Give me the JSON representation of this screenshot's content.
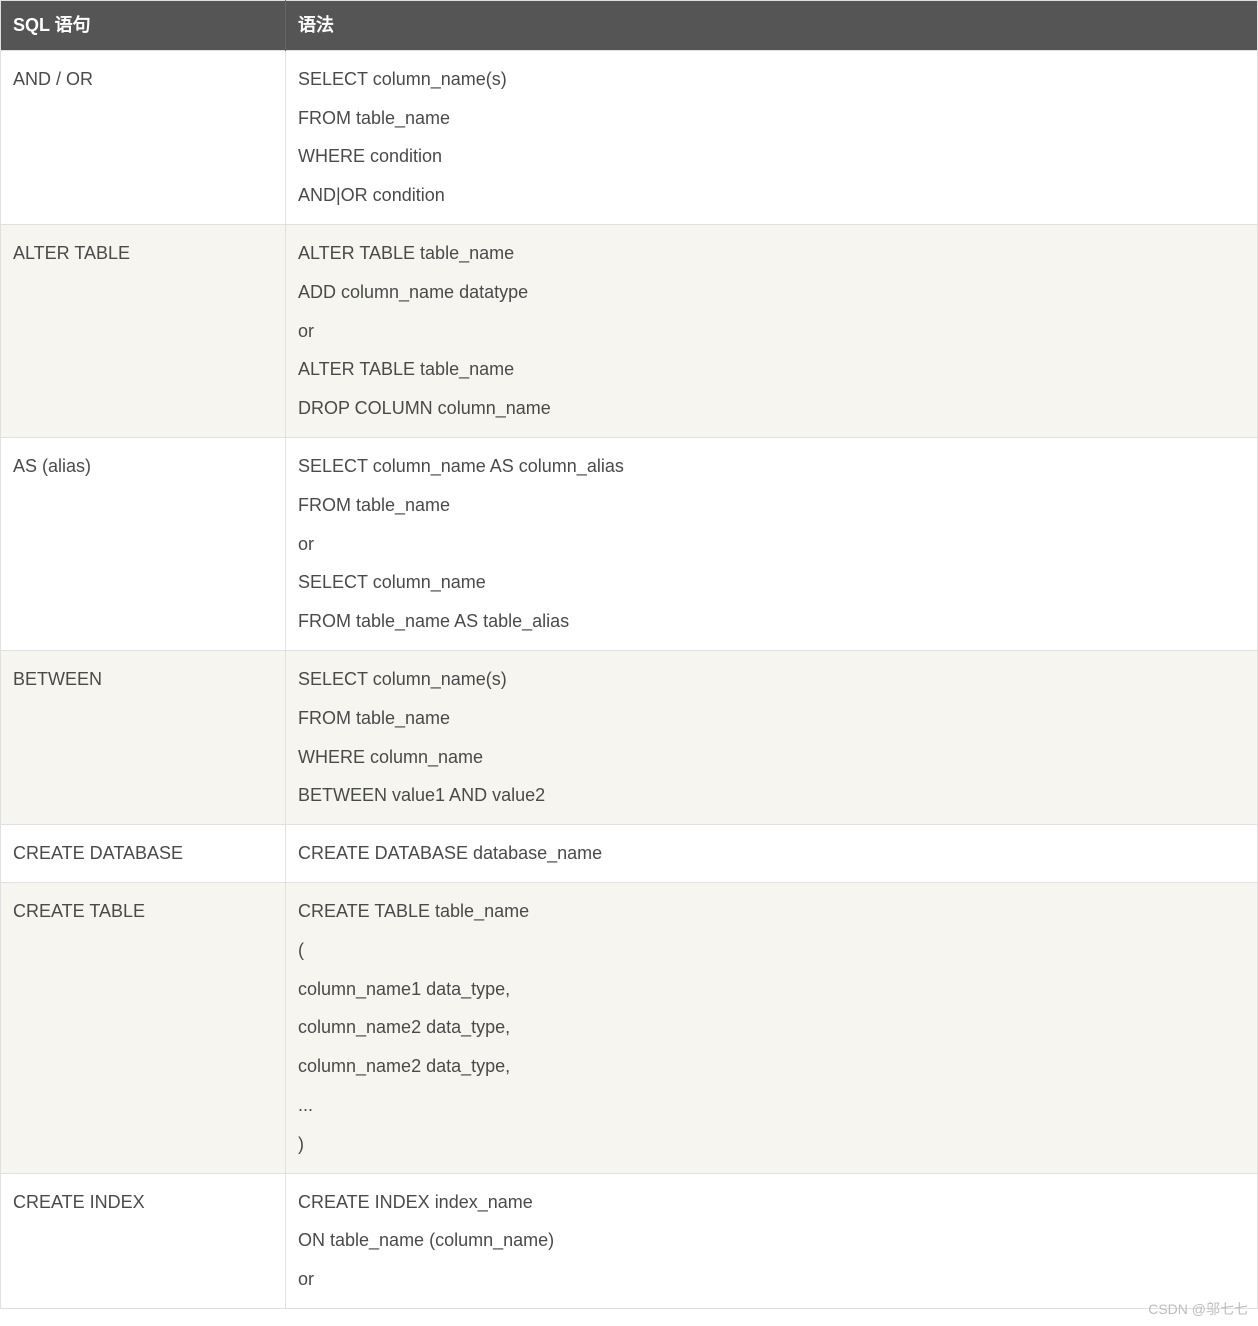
{
  "headers": {
    "col1": "SQL 语句",
    "col2": "语法"
  },
  "rows": [
    {
      "statement": "AND / OR",
      "syntax": [
        "SELECT column_name(s)",
        "FROM table_name",
        "WHERE condition",
        "AND|OR condition"
      ]
    },
    {
      "statement": "ALTER TABLE",
      "syntax": [
        "ALTER TABLE table_name",
        "ADD column_name datatype",
        "or",
        "ALTER TABLE table_name",
        "DROP COLUMN column_name"
      ]
    },
    {
      "statement": "AS (alias)",
      "syntax": [
        "SELECT column_name AS column_alias",
        "FROM table_name",
        "or",
        "SELECT column_name",
        "FROM table_name AS table_alias"
      ]
    },
    {
      "statement": "BETWEEN",
      "syntax": [
        "SELECT column_name(s)",
        "FROM table_name",
        "WHERE column_name",
        "BETWEEN value1 AND value2"
      ]
    },
    {
      "statement": "CREATE DATABASE",
      "syntax": [
        "CREATE DATABASE database_name"
      ]
    },
    {
      "statement": "CREATE TABLE",
      "syntax": [
        "CREATE TABLE table_name",
        "(",
        "column_name1 data_type,",
        "column_name2 data_type,",
        "column_name2 data_type,",
        "...",
        ")"
      ]
    },
    {
      "statement": "CREATE INDEX",
      "syntax": [
        "CREATE INDEX index_name",
        "ON table_name (column_name)",
        "or"
      ]
    }
  ],
  "watermark": "CSDN @邬七七"
}
